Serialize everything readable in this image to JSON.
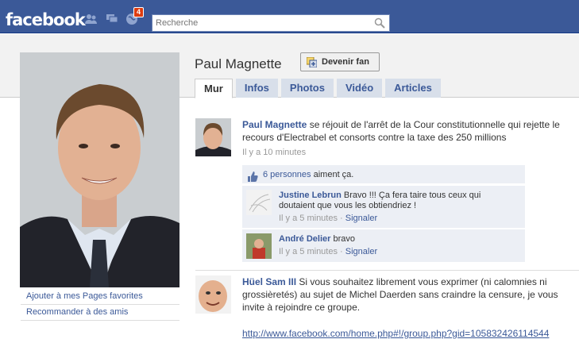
{
  "topbar": {
    "logo": "facebook",
    "notif_count": "4",
    "search_placeholder": "Recherche",
    "icons": [
      "friends-icon",
      "messages-icon",
      "notifications-icon",
      "search-icon"
    ]
  },
  "profile": {
    "name": "Paul Magnette",
    "fan_button": "Devenir fan",
    "tabs": [
      "Mur",
      "Infos",
      "Photos",
      "Vidéo",
      "Articles"
    ],
    "active_tab": "Mur",
    "side_links": [
      "Ajouter à mes Pages favorites",
      "Recommander à des amis"
    ]
  },
  "post1": {
    "author": "Paul Magnette",
    "text": "se réjouit de l'arrêt de la Cour constitutionnelle qui rejette le recours d'Electrabel et consorts contre la taxe des 250 millions",
    "time": "Il y a 10 minutes",
    "likes_link": "6 personnes",
    "likes_text": "aiment ça.",
    "comments": [
      {
        "author": "Justine Lebrun",
        "text": "Bravo !!! Ça fera taire tous ceux qui doutaient que vous les obtiendriez !",
        "time": "Il y a 5 minutes",
        "report": "Signaler"
      },
      {
        "author": "André Delier",
        "text": "bravo",
        "time": "Il y a 5 minutes",
        "report": "Signaler"
      }
    ]
  },
  "post2": {
    "author": "Hüel Sam III",
    "text": "Si vous souhaitez librement vous exprimer (ni calomnies ni grossièretés) au sujet de Michel Daerden sans craindre la censure, je vous invite à rejoindre ce groupe.",
    "url": "http://www.facebook.com/home.php#!/group.php?gid=105832426114544"
  },
  "colors": {
    "brand_blue": "#3b5998",
    "tab_bg": "#d8dfea",
    "comment_bg": "#eceff5",
    "badge_red": "#dd3c10"
  }
}
